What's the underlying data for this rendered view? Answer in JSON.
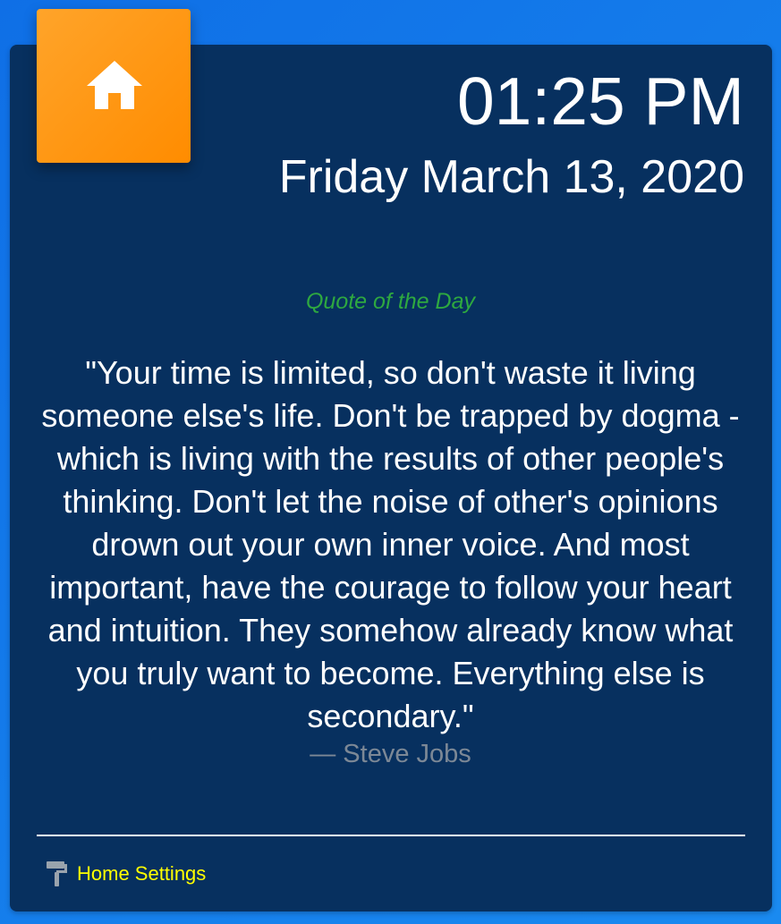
{
  "header": {
    "home_icon": "home-icon",
    "time": "01:25 PM",
    "date": "Friday March 13, 2020"
  },
  "quote": {
    "label": "Quote of the Day",
    "text": "\"Your time is limited, so don't waste it living someone else's life. Don't be trapped by dogma - which is living with the results of other people's thinking. Don't let the noise of other's opinions drown out your own inner voice. And most important, have the courage to follow your heart and intuition. They somehow already know what you truly want to become. Everything else is secondary.\"",
    "author": "— Steve Jobs"
  },
  "footer": {
    "settings_icon": "paint-roller-icon",
    "settings_label": "Home Settings"
  },
  "colors": {
    "background": "#1a8af0",
    "card": "#07305f",
    "home_tile": "#ff8c00",
    "quote_label": "#2ea840",
    "author": "#7c8896",
    "settings_link": "#ffff00"
  }
}
